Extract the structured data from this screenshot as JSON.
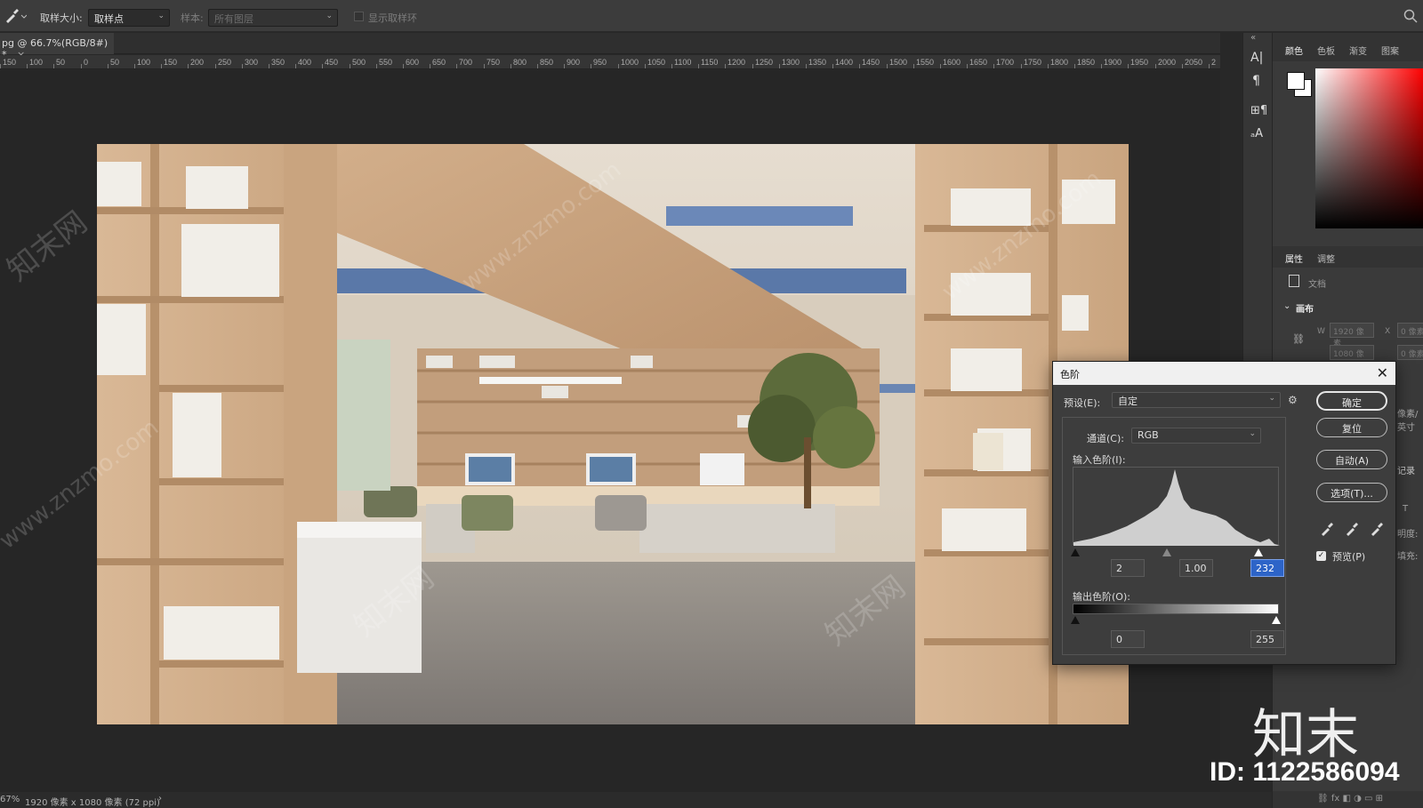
{
  "options_bar": {
    "sample_size_label": "取样大小:",
    "sample_size_value": "取样点",
    "sample_label": "样本:",
    "sample_value": "所有图层",
    "show_ring_label": "显示取样环"
  },
  "document_tab": {
    "title": "pg @ 66.7%(RGB/8#) *",
    "close": "×"
  },
  "ruler": {
    "ticks": [
      "150",
      "100",
      "50",
      "0",
      "50",
      "100",
      "150",
      "200",
      "250",
      "300",
      "350",
      "400",
      "450",
      "500",
      "550",
      "600",
      "650",
      "700",
      "750",
      "800",
      "850",
      "900",
      "950",
      "1000",
      "1050",
      "1100",
      "1150",
      "1200",
      "1250",
      "1300",
      "1350",
      "1400",
      "1450",
      "1500",
      "1550",
      "1600",
      "1650",
      "1700",
      "1750",
      "1800",
      "1850",
      "1900",
      "1950",
      "2000",
      "2050",
      "2"
    ]
  },
  "right_panel": {
    "color_tabs": [
      "颜色",
      "色板",
      "渐变",
      "图案"
    ],
    "props_tabs": [
      "属性",
      "调整"
    ],
    "doc_label": "文档",
    "canvas_label": "画布",
    "w_label": "W",
    "w_value": "1920 像素",
    "x_label": "X",
    "x_value": "0 像素",
    "h_value": "1080 像素",
    "y_value": "0 像素",
    "res_unit": "像素/英寸",
    "history_label": "记录",
    "opacity_label": "明度:",
    "fill_label": "填充:"
  },
  "levels_dialog": {
    "title": "色阶",
    "close": "✕",
    "preset_label": "预设(E):",
    "preset_value": "自定",
    "channel_label": "通道(C):",
    "channel_value": "RGB",
    "input_label": "输入色阶(I):",
    "input_black": "2",
    "input_gamma": "1.00",
    "input_white": "232",
    "output_label": "输出色阶(O):",
    "output_black": "0",
    "output_white": "255",
    "buttons": {
      "ok": "确定",
      "reset": "复位",
      "auto": "自动(A)",
      "options": "选项(T)..."
    },
    "preview_label": "预览(P)",
    "preview_checked": true
  },
  "status_bar": {
    "zoom": "67%",
    "info": "1920 像素 x 1080 像素 (72 ppi)",
    "arrow": "›"
  },
  "watermark": {
    "logo": "知末",
    "id": "ID: 1122586094",
    "text_cn": "知末网",
    "text_en": "www.znzmo.com"
  },
  "colors": {
    "accent_blue": "#4a78c2",
    "selected_value_bg": "#2d64c8",
    "panel_bg": "#3a3a3a",
    "dialog_bg": "#3d3d3d"
  },
  "icons": [
    "eyedropper-icon",
    "search-icon",
    "gear-icon",
    "close-icon",
    "checkbox-icon",
    "chevron-down-icon",
    "character-icon",
    "paragraph-icon",
    "link-icon",
    "document-icon",
    "black-point-eyedropper-icon",
    "gray-point-eyedropper-icon",
    "white-point-eyedropper-icon"
  ]
}
